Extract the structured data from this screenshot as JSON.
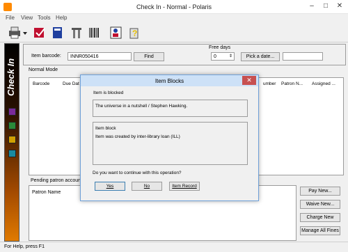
{
  "window": {
    "title": "Check In - Normal - Polaris",
    "minimize": "–",
    "maximize": "□",
    "close": "✕"
  },
  "menu": [
    "File",
    "View",
    "Tools",
    "Help"
  ],
  "toolbar": {
    "icons": [
      "print-icon",
      "dropdown-arrow-icon",
      "checkin-icon",
      "book-icon",
      "tools-icon",
      "barcode-icon",
      "patron-icon",
      "help-icon"
    ]
  },
  "sidebar": {
    "title": "Check In",
    "icons": [
      "sidebar-icon-1",
      "sidebar-icon-2",
      "sidebar-icon-3",
      "sidebar-icon-4"
    ]
  },
  "checkin": {
    "barcode_label": "Item barcode:",
    "barcode_value": "INNR050416",
    "find_label": "Find",
    "free_days_label": "Free days",
    "free_days_value": "0",
    "pick_date_label": "Pick a date...",
    "mode_label": "Normal Mode",
    "columns": {
      "barcode": "Barcode",
      "due_date": "Due Dat",
      "number": "umber",
      "patron": "Patron N...",
      "assigned": "Assigned ..."
    },
    "pending_label": "Pending patron account",
    "patron_name_col": "Patron Name"
  },
  "buttons": {
    "pay_new": "Pay New...",
    "waive_new": "Waive New...",
    "charge_new": "Charge New",
    "manage_all": "Manage All Fines"
  },
  "status": {
    "text": "For Help, press F1"
  },
  "dialog": {
    "title": "Item Blocks",
    "close": "✕",
    "blocked_label": "Item is blocked",
    "item_title": "The universe in a nutshell / Stephen Hawking.",
    "block_label": "Item block",
    "block_text": "Item was created by inter-library loan (ILL)",
    "question": "Do you want to continue with this operation?",
    "yes": "Yes",
    "no": "No",
    "item_record": "Item Record"
  },
  "colors": {
    "accent_sidebar": "#e07a00",
    "dialog_title_bg": "#cde1f7",
    "close_red": "#c75050"
  }
}
